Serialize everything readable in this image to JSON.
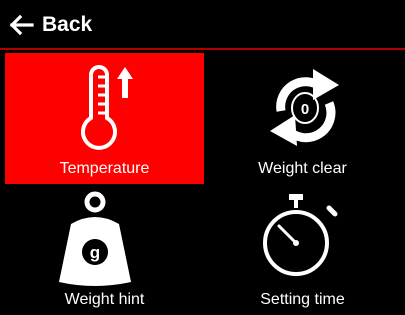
{
  "header": {
    "back_label": "Back",
    "back_icon": "arrow-left-icon"
  },
  "tiles": [
    {
      "label": "Temperature",
      "icon": "thermometer-up-icon",
      "selected": true
    },
    {
      "label": "Weight clear",
      "icon": "refresh-zero-icon",
      "selected": false
    },
    {
      "label": "Weight hint",
      "icon": "weight-g-icon",
      "selected": false,
      "icon_text": "g"
    },
    {
      "label": "Setting time",
      "icon": "stopwatch-icon",
      "selected": false
    }
  ],
  "colors": {
    "background": "#000000",
    "accent": "#ff0000",
    "text": "#ffffff",
    "header_divider": "#b00000"
  }
}
